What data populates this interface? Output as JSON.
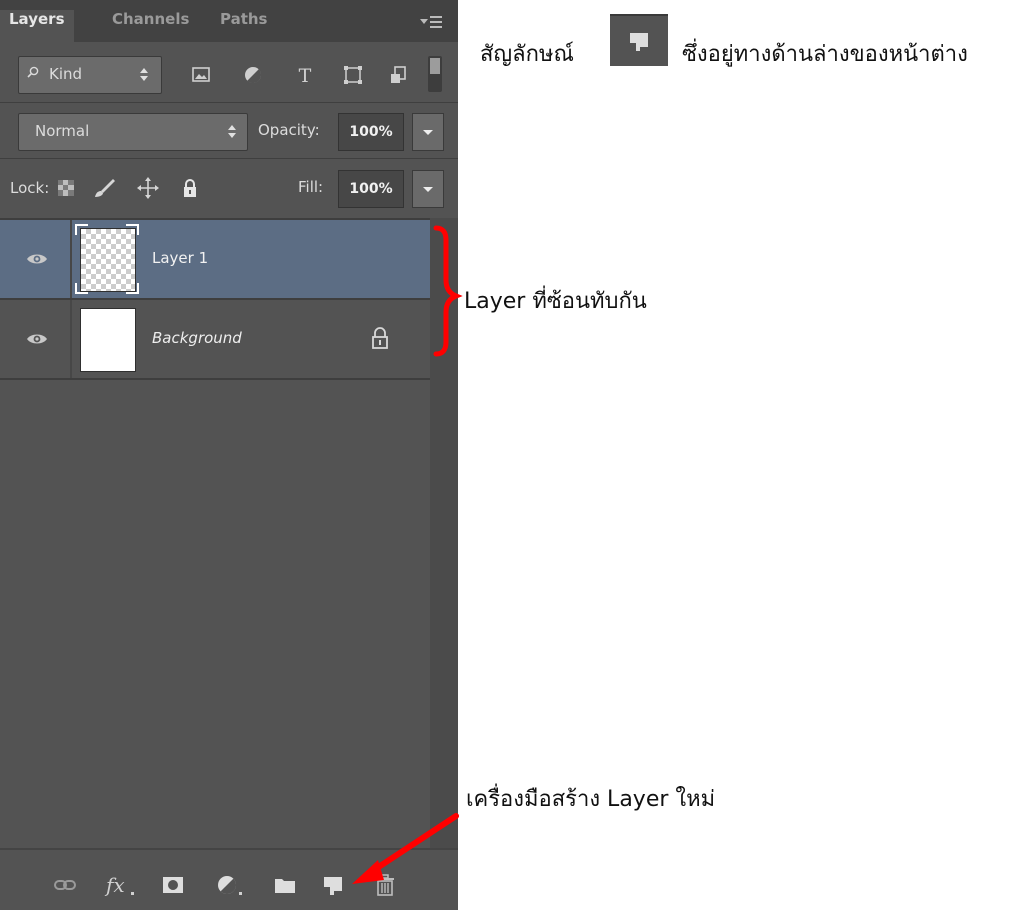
{
  "panel": {
    "tabs": [
      "Layers",
      "Channels",
      "Paths"
    ],
    "active_tab": "Layers",
    "filter": {
      "label": "Kind"
    },
    "blend_mode": "Normal",
    "opacity_label": "Opacity:",
    "opacity_value": "100%",
    "lock_label": "Lock:",
    "fill_label": "Fill:",
    "fill_value": "100%",
    "layers": [
      {
        "name": "Layer 1",
        "visible": true,
        "selected": true,
        "thumbnail": "transparent"
      },
      {
        "name": "Background",
        "visible": true,
        "selected": false,
        "locked": true,
        "thumbnail": "white"
      }
    ],
    "bottom_icons": [
      "link-icon",
      "fx-icon",
      "mask-icon",
      "adjustment-icon",
      "folder-icon",
      "new-layer-icon",
      "trash-icon"
    ]
  },
  "annotations": {
    "symbol_prefix": "สัญลักษณ์",
    "symbol_suffix": "ซึ่งอยู่ทางด้านล่างของหน้าต่าง",
    "overlapping_layers": "Layer ที่ซ้อนทับกัน",
    "new_layer_tool": "เครื่องมือสร้าง Layer ใหม่"
  },
  "colors": {
    "panel_bg": "#535353",
    "selected_layer": "#5c6d84",
    "annotation_red": "#ff0000"
  }
}
